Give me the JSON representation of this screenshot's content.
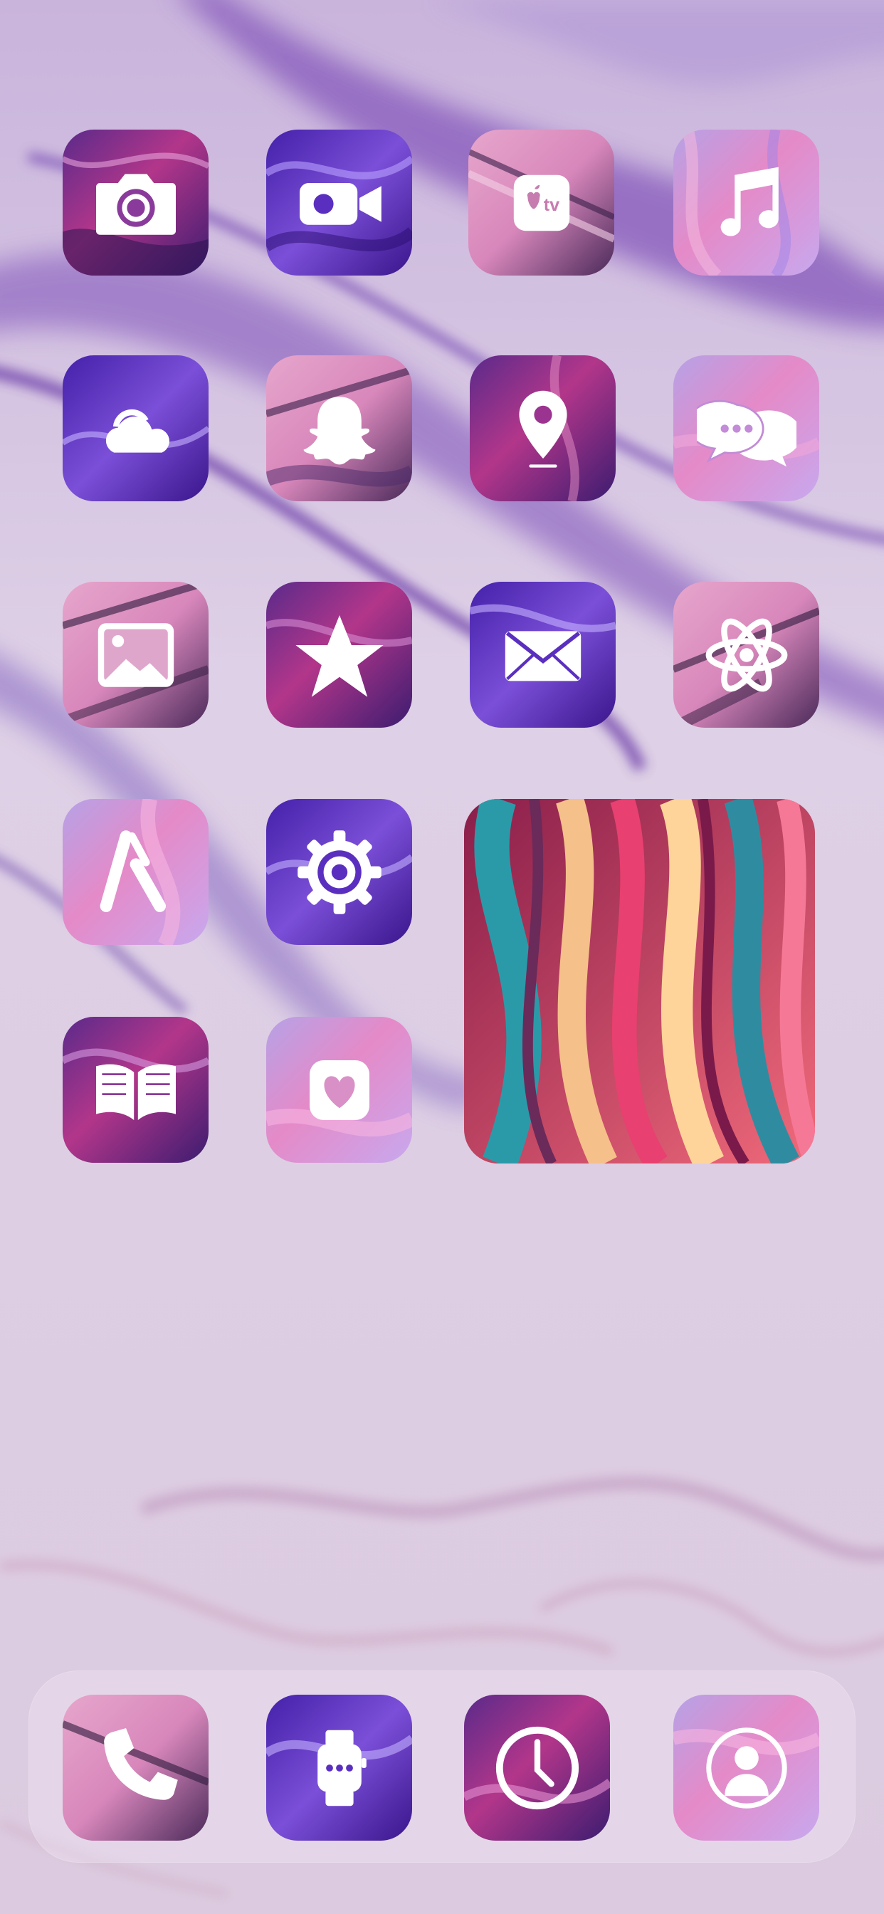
{
  "screen": {
    "type": "ios-home-screen",
    "theme": "purple-pink marble"
  },
  "apps": [
    {
      "name": "camera",
      "icon": "camera-icon",
      "style": "purple-magenta"
    },
    {
      "name": "facetime",
      "icon": "video-camera-icon",
      "style": "deep-purple"
    },
    {
      "name": "tv",
      "icon": "apple-tv-icon",
      "style": "pink-stripe"
    },
    {
      "name": "music",
      "icon": "music-note-icon",
      "style": "pastel-pink"
    },
    {
      "name": "weather",
      "icon": "cloud-sun-icon",
      "style": "deep-purple"
    },
    {
      "name": "snapchat",
      "icon": "ghost-icon",
      "style": "pink-stripe"
    },
    {
      "name": "maps",
      "icon": "location-pin-icon",
      "style": "purple-magenta"
    },
    {
      "name": "messages",
      "icon": "chat-bubbles-icon",
      "style": "pastel-pink"
    },
    {
      "name": "photos",
      "icon": "image-icon",
      "style": "pink-stripe"
    },
    {
      "name": "itunes-store",
      "icon": "star-icon",
      "style": "purple-magenta"
    },
    {
      "name": "mail",
      "icon": "envelope-icon",
      "style": "deep-purple"
    },
    {
      "name": "react-app",
      "icon": "atom-icon",
      "style": "pink-stripe"
    },
    {
      "name": "app-store",
      "icon": "app-store-icon",
      "style": "pastel-pink"
    },
    {
      "name": "settings",
      "icon": "gear-icon",
      "style": "deep-purple"
    },
    {
      "name": "books",
      "icon": "open-book-icon",
      "style": "purple-magenta"
    },
    {
      "name": "health",
      "icon": "heart-icon",
      "style": "pastel-pink"
    }
  ],
  "widget": {
    "name": "photo-widget",
    "style": "fluid-art"
  },
  "dock": [
    {
      "name": "phone",
      "icon": "phone-icon",
      "style": "pink-stripe"
    },
    {
      "name": "watch",
      "icon": "watch-icon",
      "style": "deep-purple"
    },
    {
      "name": "clock",
      "icon": "clock-icon",
      "style": "purple-magenta"
    },
    {
      "name": "contacts",
      "icon": "person-icon",
      "style": "pastel-pink"
    }
  ],
  "colors": {
    "wallpaper_base": "#d9c8e0",
    "wallpaper_swirl": "#8c5fb8",
    "glyph": "#ffffff"
  }
}
